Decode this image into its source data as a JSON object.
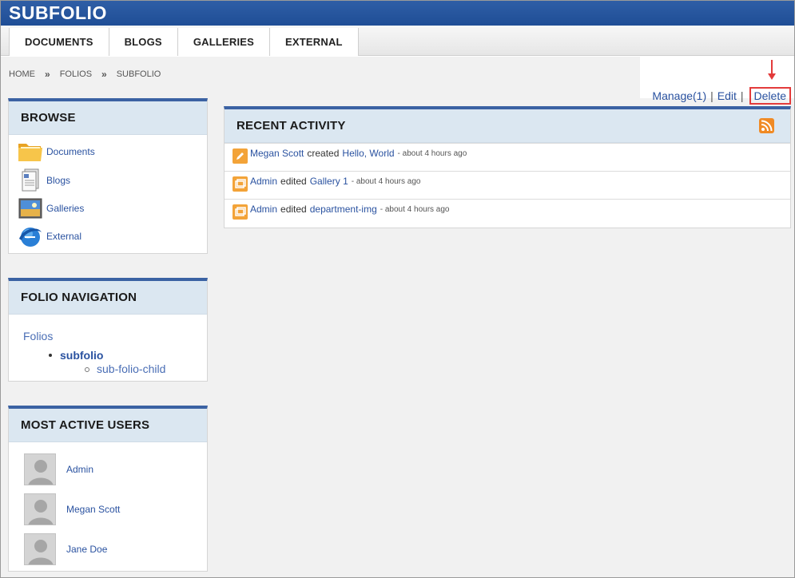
{
  "header": {
    "title": "SUBFOLIO"
  },
  "nav": {
    "tabs": [
      "DOCUMENTS",
      "BLOGS",
      "GALLERIES",
      "EXTERNAL"
    ]
  },
  "breadcrumb": {
    "items": [
      "HOME",
      "FOLIOS",
      "SUBFOLIO"
    ],
    "separator": "»"
  },
  "actions": {
    "manage": "Manage(1)",
    "separator": "|",
    "edit": "Edit",
    "delete": "Delete"
  },
  "browse": {
    "title": "BROWSE",
    "items": [
      {
        "label": "Documents",
        "icon": "folder-icon"
      },
      {
        "label": "Blogs",
        "icon": "document-icon"
      },
      {
        "label": "Galleries",
        "icon": "picture-icon"
      },
      {
        "label": "External",
        "icon": "globe-icon"
      }
    ]
  },
  "folio_nav": {
    "title": "FOLIO NAVIGATION",
    "root": "Folios",
    "current": "subfolio",
    "child": "sub-folio-child"
  },
  "users": {
    "title": "MOST ACTIVE USERS",
    "items": [
      "Admin",
      "Megan Scott",
      "Jane Doe"
    ]
  },
  "activity": {
    "title": "RECENT ACTIVITY",
    "items": [
      {
        "user": "Megan Scott",
        "verb": "created",
        "target": "Hello, World",
        "time": "- about 4 hours ago",
        "icon": "pencil-icon"
      },
      {
        "user": "Admin",
        "verb": "edited",
        "target": "Gallery 1",
        "time": "- about 4 hours ago",
        "icon": "gallery-icon"
      },
      {
        "user": "Admin",
        "verb": "edited",
        "target": "department-img",
        "time": "- about 4 hours ago",
        "icon": "gallery-icon"
      }
    ]
  },
  "colors": {
    "header_blue": "#1f4e96",
    "link_blue": "#2a52a0",
    "highlight_red": "#e33b3b",
    "widget_title_bg": "#dbe7f1",
    "rss_orange": "#f08a24"
  }
}
